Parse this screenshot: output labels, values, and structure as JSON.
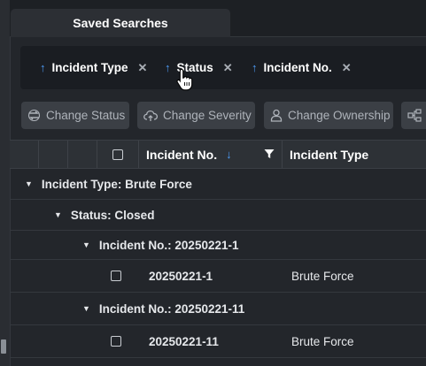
{
  "tab": {
    "label": "Saved Searches"
  },
  "group_chips": [
    {
      "label": "Incident Type",
      "sort_icon": "arrow-up-icon",
      "remove_icon": "close-icon"
    },
    {
      "label": "Status",
      "sort_icon": "arrow-up-icon",
      "remove_icon": "close-icon"
    },
    {
      "label": "Incident No.",
      "sort_icon": "arrow-up-icon",
      "remove_icon": "close-icon"
    }
  ],
  "actions": [
    {
      "label": "Change Status",
      "icon": "change-status-icon"
    },
    {
      "label": "Change Severity",
      "icon": "cloud-upload-icon"
    },
    {
      "label": "Change Ownership",
      "icon": "user-icon"
    },
    {
      "label": "",
      "icon": "workflow-icon"
    }
  ],
  "grid": {
    "columns": [
      {
        "label": "Incident No.",
        "sort": "descending",
        "filter_icon": "filter-icon"
      },
      {
        "label": "Incident Type"
      }
    ],
    "rows": [
      {
        "kind": "group",
        "level": 0,
        "label": "Incident Type: Brute Force"
      },
      {
        "kind": "group",
        "level": 1,
        "label": "Status: Closed"
      },
      {
        "kind": "group",
        "level": 2,
        "label": "Incident No.: 20250221-1"
      },
      {
        "kind": "data",
        "incident_no": "20250221-1",
        "incident_type": "Brute Force"
      },
      {
        "kind": "group",
        "level": 2,
        "label": "Incident No.: 20250221-11"
      },
      {
        "kind": "data",
        "incident_no": "20250221-11",
        "incident_type": "Brute Force"
      }
    ]
  },
  "colors": {
    "accent": "#4d9bf5",
    "background": "#23262b",
    "chip_bar": "#1a1d22",
    "button": "#3b3f45"
  }
}
